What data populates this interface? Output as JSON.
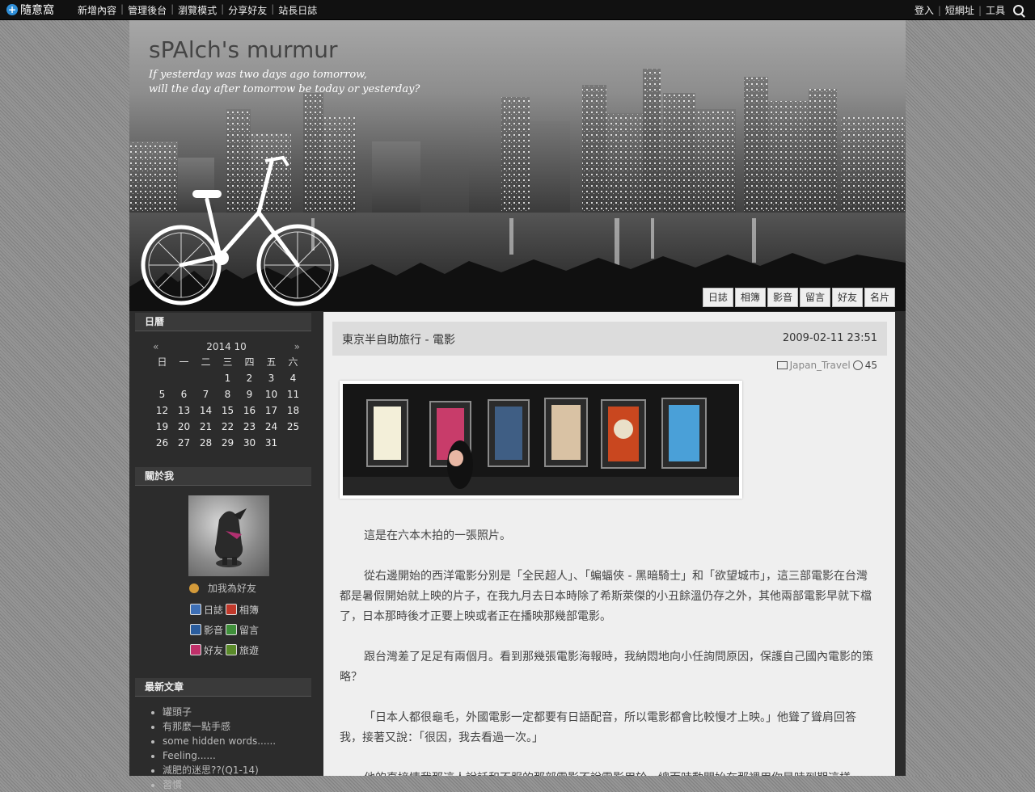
{
  "topbar": {
    "logo": "隨意窩",
    "nav": [
      "新增內容",
      "管理後台",
      "瀏覽模式",
      "分享好友",
      "站長日誌"
    ],
    "right": [
      "登入",
      "短網址",
      "工具"
    ]
  },
  "header": {
    "title": "sPAlch's murmur",
    "desc_line1": "If yesterday was two days ago tomorrow,",
    "desc_line2": "will the day after tomorrow be today or yesterday?",
    "tabs": [
      "日誌",
      "相簿",
      "影音",
      "留言",
      "好友",
      "名片"
    ]
  },
  "sidebar": {
    "calendar": {
      "heading": "日曆",
      "prev": "«",
      "month": "2014 10",
      "next": "»",
      "weekdays": [
        "日",
        "一",
        "二",
        "三",
        "四",
        "五",
        "六"
      ],
      "weeks": [
        [
          "",
          "",
          "",
          "1",
          "2",
          "3",
          "4"
        ],
        [
          "5",
          "6",
          "7",
          "8",
          "9",
          "10",
          "11"
        ],
        [
          "12",
          "13",
          "14",
          "15",
          "16",
          "17",
          "18"
        ],
        [
          "19",
          "20",
          "21",
          "22",
          "23",
          "24",
          "25"
        ],
        [
          "26",
          "27",
          "28",
          "29",
          "30",
          "31",
          ""
        ]
      ]
    },
    "about": {
      "heading": "關於我",
      "add_friend": "加我為好友",
      "links": [
        "日誌",
        "相簿",
        "影音",
        "留言",
        "好友",
        "旅遊"
      ],
      "link_colors": [
        "#3d6fb6",
        "#c0392b",
        "#2a5d9e",
        "#3f8f3a",
        "#c0306a",
        "#5a8a2a"
      ]
    },
    "latest": {
      "heading": "最新文章",
      "items": [
        "罐頭子",
        "有那麼一點手感",
        "some hidden words......",
        "Feeling......",
        "減肥的迷思??(Q1-14)",
        "習慣"
      ]
    }
  },
  "post": {
    "title": "東京半自助旅行 - 電影",
    "date": "2009-02-11 23:51",
    "category": "Japan_Travel",
    "count": "45",
    "paragraphs": [
      "這是在六本木拍的一張照片。",
      "從右邊開始的西洋電影分別是「全民超人」、「蝙蝠俠 - 黑暗騎士」和「欲望城市」，這三部電影在台灣都是暑假開始就上映的片子，在我九月去日本時除了希斯萊傑的小丑餘溫仍存之外，其他兩部電影早就下檔了，日本那時後才正要上映或者正在播映那幾部電影。",
      "跟台灣差了足足有兩個月。看到那幾張電影海報時，我納悶地向小任詢問原因，保護自己國內電影的策略？",
      "「日本人都很龜毛，外國電影一定都要有日語配音，所以電影都會比較慢才上映。」他聳了聳肩回答我，接著又說：「很因，我去看過一次。」",
      "他的直接情我那這人說話和不服的那部電影不說電影用於，總而時動開始在那裡用你是時到期這樣"
    ]
  }
}
